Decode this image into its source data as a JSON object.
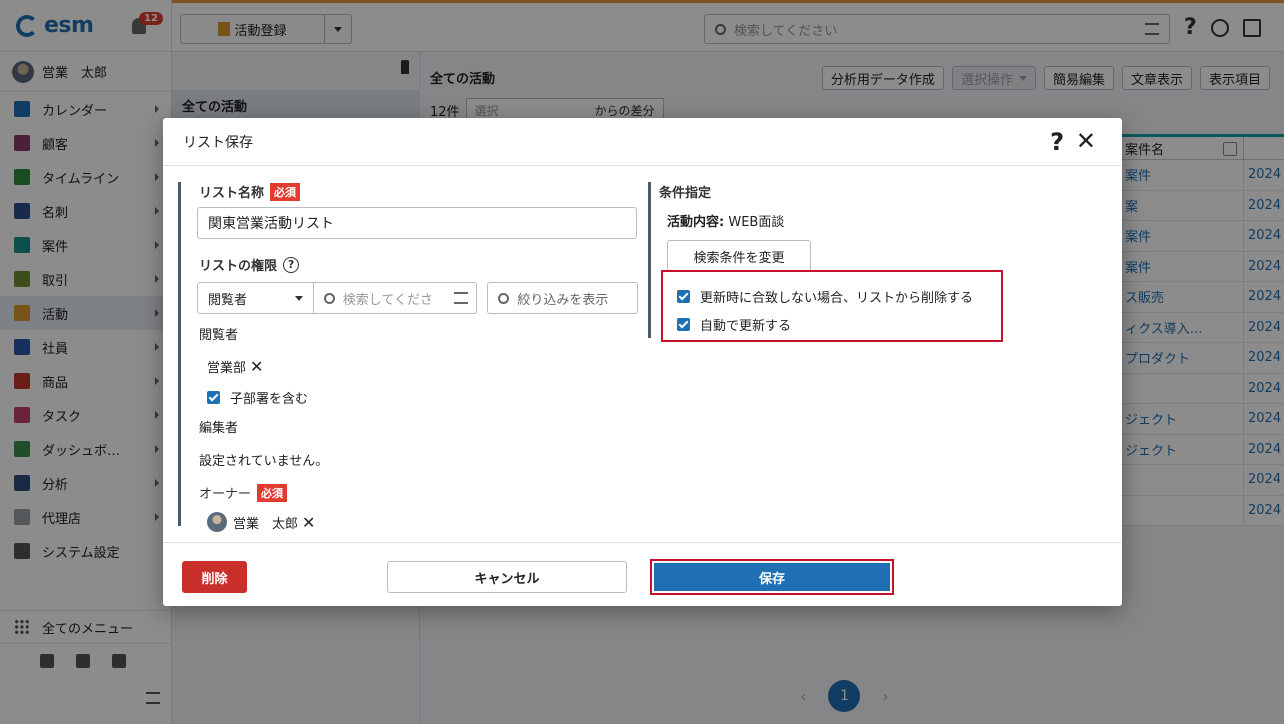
{
  "sidebar": {
    "logo": "esm",
    "notification_count": "12",
    "user_name": "営業　太郎",
    "items": [
      {
        "label": "カレンダー",
        "icon": "calendar-icon",
        "color": "#1f6fb5"
      },
      {
        "label": "顧客",
        "icon": "building-icon",
        "color": "#8a3a6b"
      },
      {
        "label": "タイムライン",
        "icon": "timeline-icon",
        "color": "#2e8b3d"
      },
      {
        "label": "名刺",
        "icon": "card-icon",
        "color": "#2d4f8b"
      },
      {
        "label": "案件",
        "icon": "folder-icon",
        "color": "#1a8f8a"
      },
      {
        "label": "取引",
        "icon": "deal-icon",
        "color": "#6d8d2f"
      },
      {
        "label": "活動",
        "icon": "clipboard-icon",
        "color": "#d99a2b"
      },
      {
        "label": "社員",
        "icon": "person-icon",
        "color": "#2b5aa8"
      },
      {
        "label": "商品",
        "icon": "box-icon",
        "color": "#c0392b"
      },
      {
        "label": "タスク",
        "icon": "task-icon",
        "color": "#c2436a"
      },
      {
        "label": "ダッシュボ…",
        "icon": "dashboard-icon",
        "color": "#3a8f4b"
      },
      {
        "label": "分析",
        "icon": "chart-icon",
        "color": "#2e4f7d"
      },
      {
        "label": "代理店",
        "icon": "agency-icon",
        "color": "#9aa0a6"
      },
      {
        "label": "システム設定",
        "icon": "gear-icon",
        "color": "#555555"
      }
    ],
    "all_menu": "全てのメニュー"
  },
  "topbar": {
    "activity_register": "活動登録",
    "search_placeholder": "検索してください"
  },
  "filter_panel": {
    "title": "全ての活動"
  },
  "content": {
    "title": "全ての活動",
    "toolbar": {
      "analysis": "分析用データ作成",
      "select_ops": "選択操作",
      "quick_edit": "簡易編集",
      "text_view": "文章表示",
      "display_items": "表示項目"
    },
    "count": "12件",
    "diff_placeholder": "選択",
    "diff_suffix": "からの差分",
    "column_header": "案件名",
    "rows": [
      {
        "name": "案件",
        "date": "2024"
      },
      {
        "name": "案",
        "date": "2024"
      },
      {
        "name": "案件",
        "date": "2024"
      },
      {
        "name": "案件",
        "date": "2024"
      },
      {
        "name": "ス販売",
        "date": "2024"
      },
      {
        "name": "ィクス導入…",
        "date": "2024"
      },
      {
        "name": "プロダクト",
        "date": "2024"
      },
      {
        "name": "",
        "date": "2024"
      },
      {
        "name": "ジェクト",
        "date": "2024"
      },
      {
        "name": "ジェクト",
        "date": "2024"
      },
      {
        "name": "",
        "date": "2024"
      },
      {
        "name": "",
        "date": "2024"
      }
    ],
    "page": "1"
  },
  "modal": {
    "title": "リスト保存",
    "list_name_label": "リスト名称",
    "required": "必須",
    "list_name_value": "関東営業活動リスト",
    "permission_label": "リストの権限",
    "permission_role": "閲覧者",
    "permission_search_placeholder": "検索してくださ",
    "narrow_button": "絞り込みを表示",
    "viewers_label": "閲覧者",
    "viewer_tag": "営業部",
    "include_sub": "子部署を含む",
    "editors_label": "編集者",
    "editors_none": "設定されていません。",
    "owner_label": "オーナー",
    "owner_name": "営業　太郎",
    "condition_label": "条件指定",
    "condition_key": "活動内容:",
    "condition_value": "WEB面談",
    "change_condition": "検索条件を変更",
    "remove_unmatched": "更新時に合致しない場合、リストから削除する",
    "auto_update": "自動で更新する",
    "delete": "削除",
    "cancel": "キャンセル",
    "save": "保存"
  }
}
